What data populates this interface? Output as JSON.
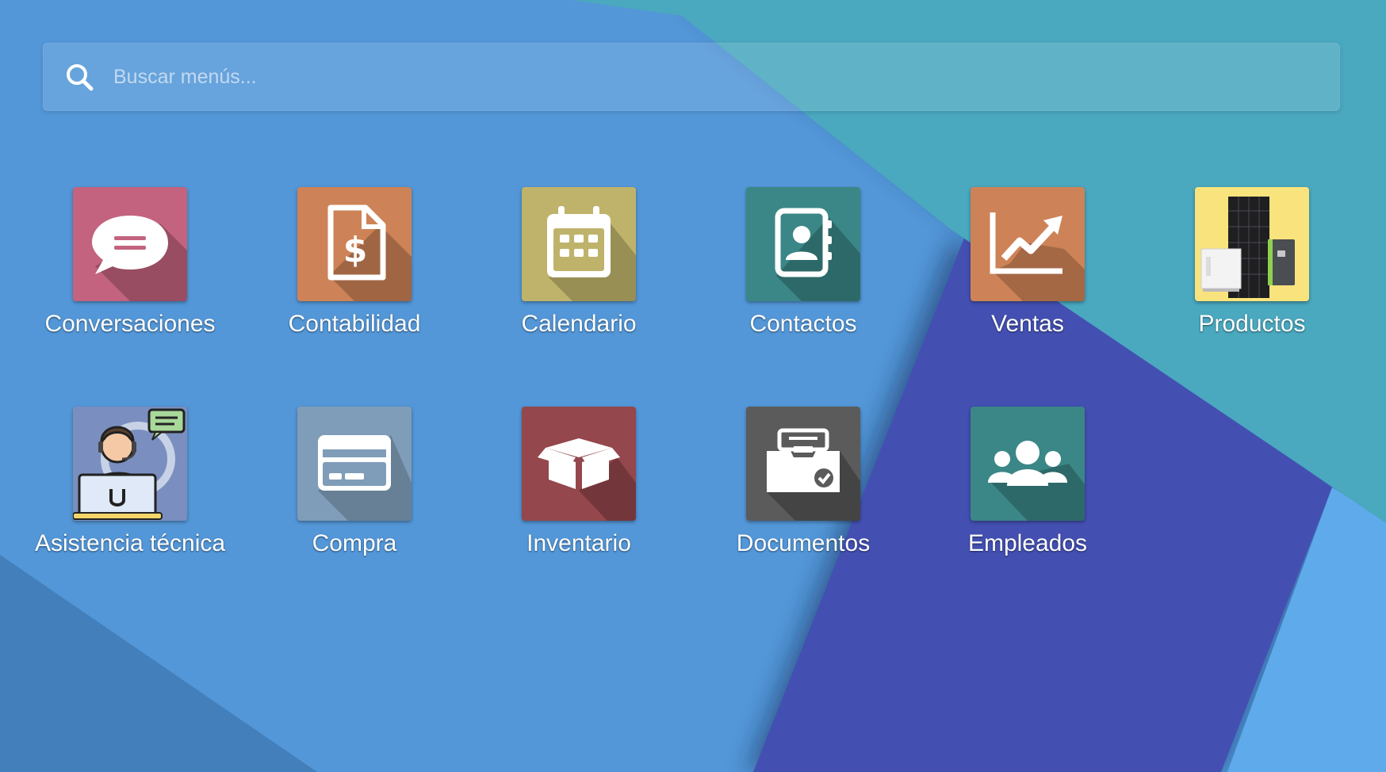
{
  "search": {
    "placeholder": "Buscar menús..."
  },
  "apps": [
    {
      "label": "Conversaciones",
      "icon": "chat-bubble-icon",
      "color": "#c3637f"
    },
    {
      "label": "Contabilidad",
      "icon": "invoice-dollar-icon",
      "color": "#cd8357"
    },
    {
      "label": "Calendario",
      "icon": "calendar-icon",
      "color": "#bfb36b"
    },
    {
      "label": "Contactos",
      "icon": "address-book-icon",
      "color": "#3b8787"
    },
    {
      "label": "Ventas",
      "icon": "trend-chart-icon",
      "color": "#cd8357"
    },
    {
      "label": "Productos",
      "icon": "solar-panel-inverter-icon",
      "color": "#f9e37c"
    },
    {
      "label": "Asistencia técnica",
      "icon": "support-agent-icon",
      "color": "#7a8fbf"
    },
    {
      "label": "Compra",
      "icon": "credit-card-icon",
      "color": "#7f9db8"
    },
    {
      "label": "Inventario",
      "icon": "box-icon",
      "color": "#94474c"
    },
    {
      "label": "Documentos",
      "icon": "document-inbox-icon",
      "color": "#5b5b5b"
    },
    {
      "label": "Empleados",
      "icon": "users-group-icon",
      "color": "#3b8787"
    }
  ]
}
